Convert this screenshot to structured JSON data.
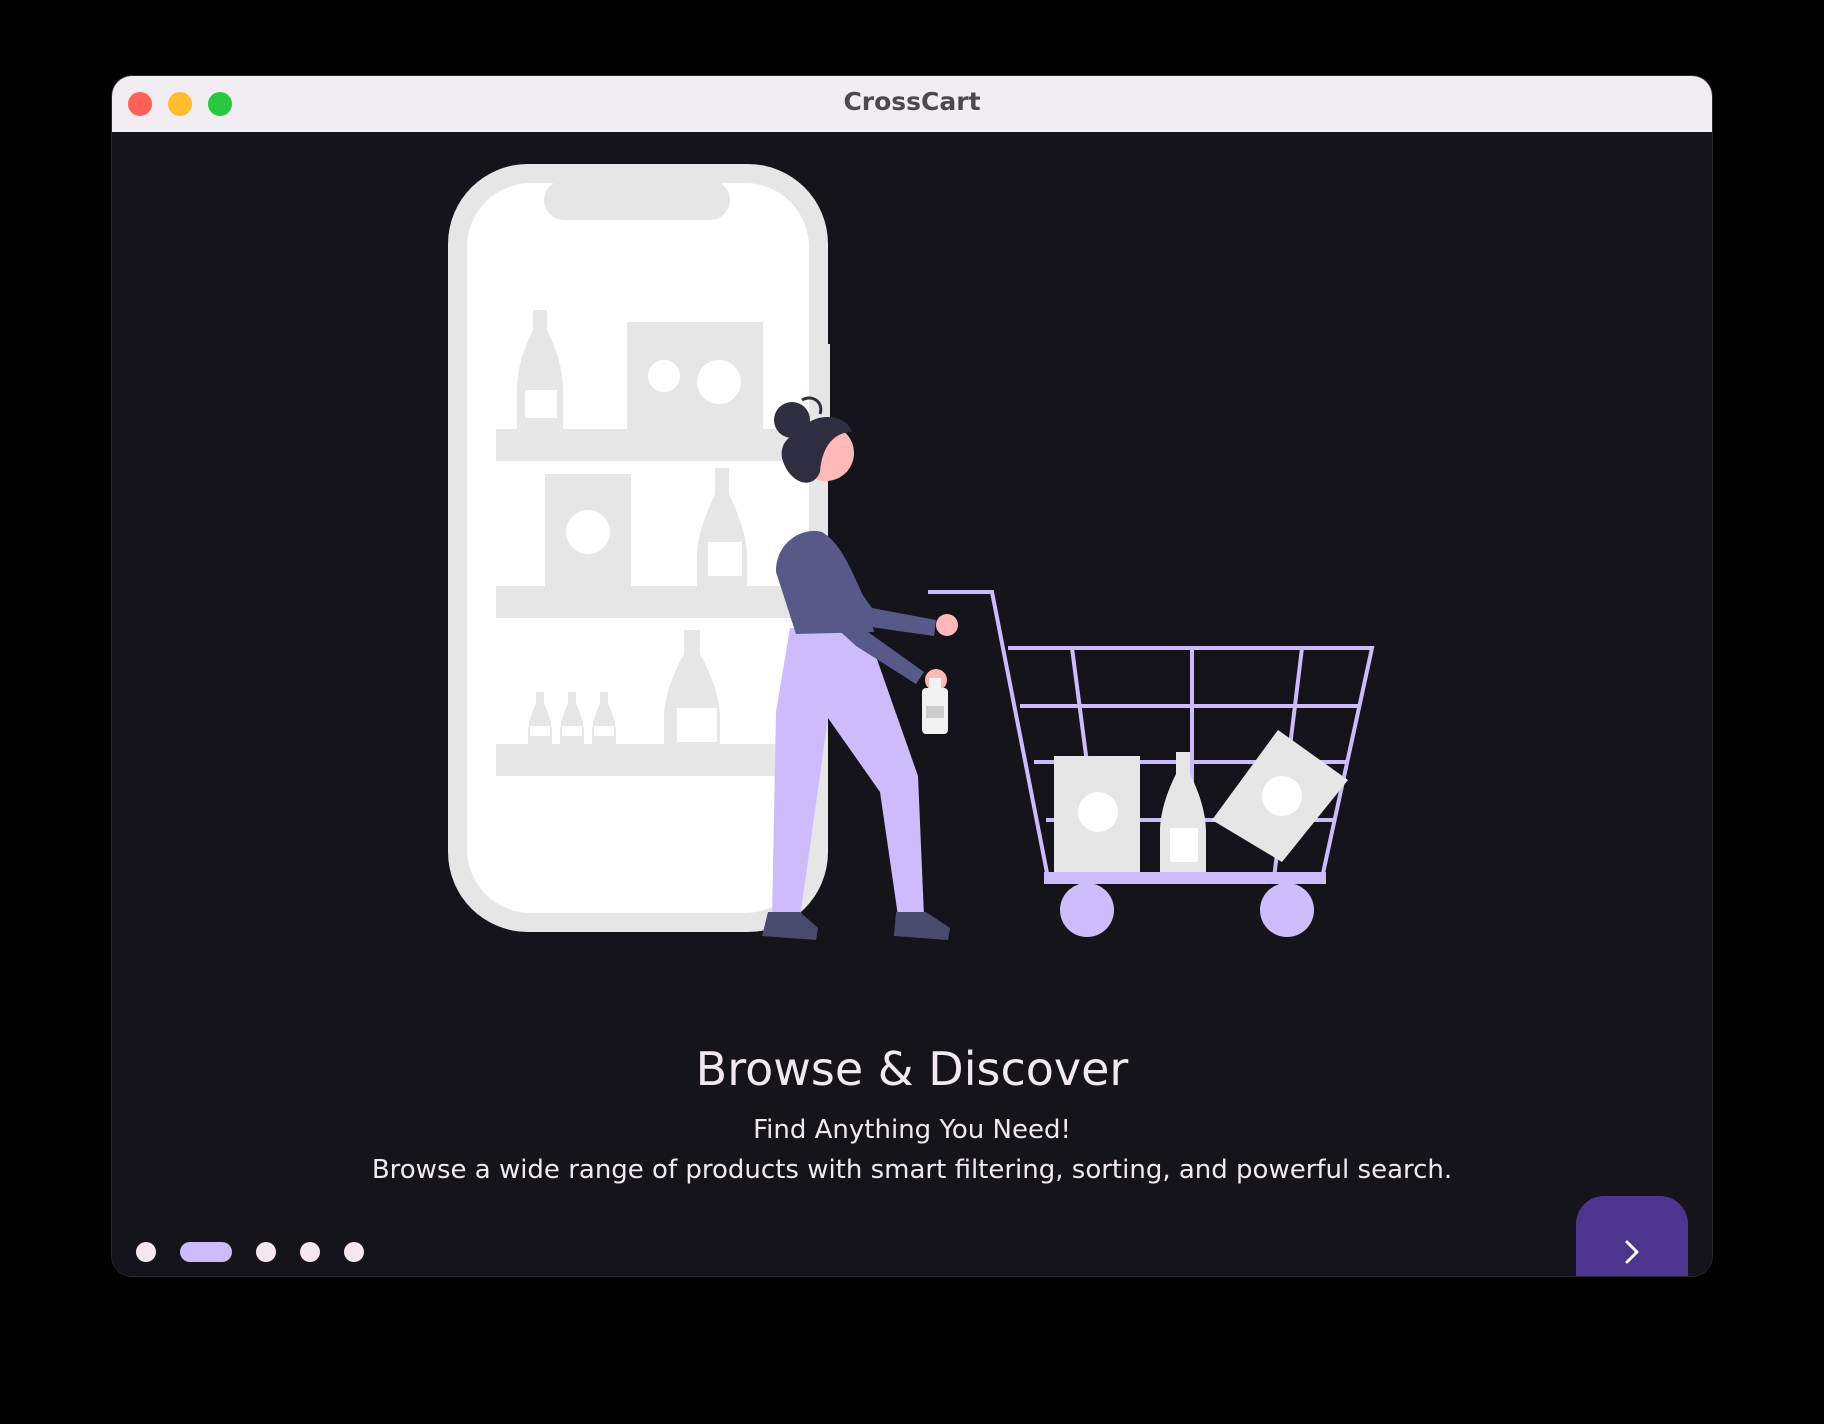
{
  "window": {
    "title": "CrossCart"
  },
  "onboarding": {
    "title": "Browse & Discover",
    "subtitle": "Find Anything You Need!",
    "description": "Browse a wide range of products with smart filtering, sorting, and powerful search.",
    "page_count": 5,
    "current_page": 2
  },
  "icons": {
    "next": "chevron-right-icon",
    "illustration": "shopping-cart-illustration"
  },
  "colors": {
    "background": "#14141a",
    "titlebar": "#f2edf2",
    "accent": "#cdbcfb",
    "button": "#4c358f",
    "dot": "#f5e6ee",
    "text": "#f0e9ef",
    "close": "#fe5f57",
    "minimize": "#febc2e",
    "maximize": "#28c840"
  }
}
